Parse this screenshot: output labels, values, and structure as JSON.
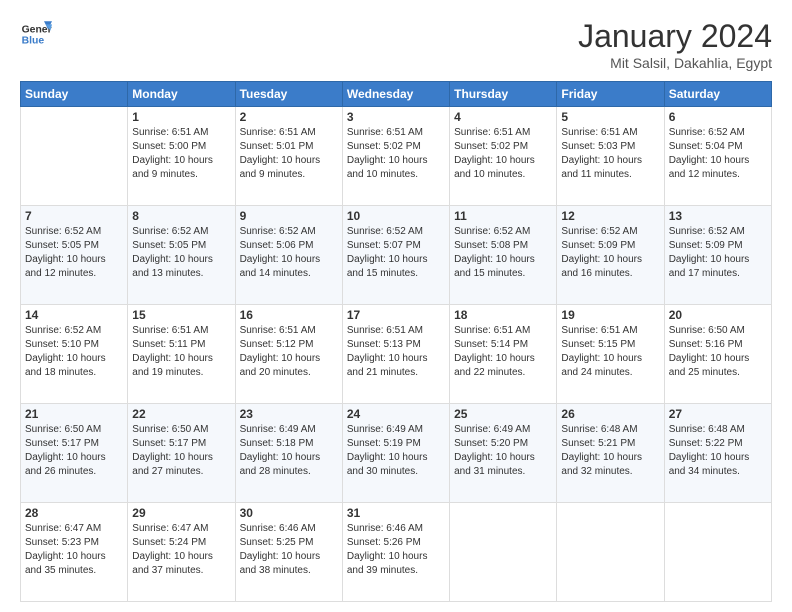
{
  "header": {
    "logo": {
      "line1": "General",
      "line2": "Blue"
    },
    "title": "January 2024",
    "location": "Mit Salsil, Dakahlia, Egypt"
  },
  "calendar": {
    "headers": [
      "Sunday",
      "Monday",
      "Tuesday",
      "Wednesday",
      "Thursday",
      "Friday",
      "Saturday"
    ],
    "weeks": [
      [
        {
          "day": "",
          "info": ""
        },
        {
          "day": "1",
          "info": "Sunrise: 6:51 AM\nSunset: 5:00 PM\nDaylight: 10 hours\nand 9 minutes."
        },
        {
          "day": "2",
          "info": "Sunrise: 6:51 AM\nSunset: 5:01 PM\nDaylight: 10 hours\nand 9 minutes."
        },
        {
          "day": "3",
          "info": "Sunrise: 6:51 AM\nSunset: 5:02 PM\nDaylight: 10 hours\nand 10 minutes."
        },
        {
          "day": "4",
          "info": "Sunrise: 6:51 AM\nSunset: 5:02 PM\nDaylight: 10 hours\nand 10 minutes."
        },
        {
          "day": "5",
          "info": "Sunrise: 6:51 AM\nSunset: 5:03 PM\nDaylight: 10 hours\nand 11 minutes."
        },
        {
          "day": "6",
          "info": "Sunrise: 6:52 AM\nSunset: 5:04 PM\nDaylight: 10 hours\nand 12 minutes."
        }
      ],
      [
        {
          "day": "7",
          "info": "Sunrise: 6:52 AM\nSunset: 5:05 PM\nDaylight: 10 hours\nand 12 minutes."
        },
        {
          "day": "8",
          "info": "Sunrise: 6:52 AM\nSunset: 5:05 PM\nDaylight: 10 hours\nand 13 minutes."
        },
        {
          "day": "9",
          "info": "Sunrise: 6:52 AM\nSunset: 5:06 PM\nDaylight: 10 hours\nand 14 minutes."
        },
        {
          "day": "10",
          "info": "Sunrise: 6:52 AM\nSunset: 5:07 PM\nDaylight: 10 hours\nand 15 minutes."
        },
        {
          "day": "11",
          "info": "Sunrise: 6:52 AM\nSunset: 5:08 PM\nDaylight: 10 hours\nand 15 minutes."
        },
        {
          "day": "12",
          "info": "Sunrise: 6:52 AM\nSunset: 5:09 PM\nDaylight: 10 hours\nand 16 minutes."
        },
        {
          "day": "13",
          "info": "Sunrise: 6:52 AM\nSunset: 5:09 PM\nDaylight: 10 hours\nand 17 minutes."
        }
      ],
      [
        {
          "day": "14",
          "info": "Sunrise: 6:52 AM\nSunset: 5:10 PM\nDaylight: 10 hours\nand 18 minutes."
        },
        {
          "day": "15",
          "info": "Sunrise: 6:51 AM\nSunset: 5:11 PM\nDaylight: 10 hours\nand 19 minutes."
        },
        {
          "day": "16",
          "info": "Sunrise: 6:51 AM\nSunset: 5:12 PM\nDaylight: 10 hours\nand 20 minutes."
        },
        {
          "day": "17",
          "info": "Sunrise: 6:51 AM\nSunset: 5:13 PM\nDaylight: 10 hours\nand 21 minutes."
        },
        {
          "day": "18",
          "info": "Sunrise: 6:51 AM\nSunset: 5:14 PM\nDaylight: 10 hours\nand 22 minutes."
        },
        {
          "day": "19",
          "info": "Sunrise: 6:51 AM\nSunset: 5:15 PM\nDaylight: 10 hours\nand 24 minutes."
        },
        {
          "day": "20",
          "info": "Sunrise: 6:50 AM\nSunset: 5:16 PM\nDaylight: 10 hours\nand 25 minutes."
        }
      ],
      [
        {
          "day": "21",
          "info": "Sunrise: 6:50 AM\nSunset: 5:17 PM\nDaylight: 10 hours\nand 26 minutes."
        },
        {
          "day": "22",
          "info": "Sunrise: 6:50 AM\nSunset: 5:17 PM\nDaylight: 10 hours\nand 27 minutes."
        },
        {
          "day": "23",
          "info": "Sunrise: 6:49 AM\nSunset: 5:18 PM\nDaylight: 10 hours\nand 28 minutes."
        },
        {
          "day": "24",
          "info": "Sunrise: 6:49 AM\nSunset: 5:19 PM\nDaylight: 10 hours\nand 30 minutes."
        },
        {
          "day": "25",
          "info": "Sunrise: 6:49 AM\nSunset: 5:20 PM\nDaylight: 10 hours\nand 31 minutes."
        },
        {
          "day": "26",
          "info": "Sunrise: 6:48 AM\nSunset: 5:21 PM\nDaylight: 10 hours\nand 32 minutes."
        },
        {
          "day": "27",
          "info": "Sunrise: 6:48 AM\nSunset: 5:22 PM\nDaylight: 10 hours\nand 34 minutes."
        }
      ],
      [
        {
          "day": "28",
          "info": "Sunrise: 6:47 AM\nSunset: 5:23 PM\nDaylight: 10 hours\nand 35 minutes."
        },
        {
          "day": "29",
          "info": "Sunrise: 6:47 AM\nSunset: 5:24 PM\nDaylight: 10 hours\nand 37 minutes."
        },
        {
          "day": "30",
          "info": "Sunrise: 6:46 AM\nSunset: 5:25 PM\nDaylight: 10 hours\nand 38 minutes."
        },
        {
          "day": "31",
          "info": "Sunrise: 6:46 AM\nSunset: 5:26 PM\nDaylight: 10 hours\nand 39 minutes."
        },
        {
          "day": "",
          "info": ""
        },
        {
          "day": "",
          "info": ""
        },
        {
          "day": "",
          "info": ""
        }
      ]
    ]
  }
}
